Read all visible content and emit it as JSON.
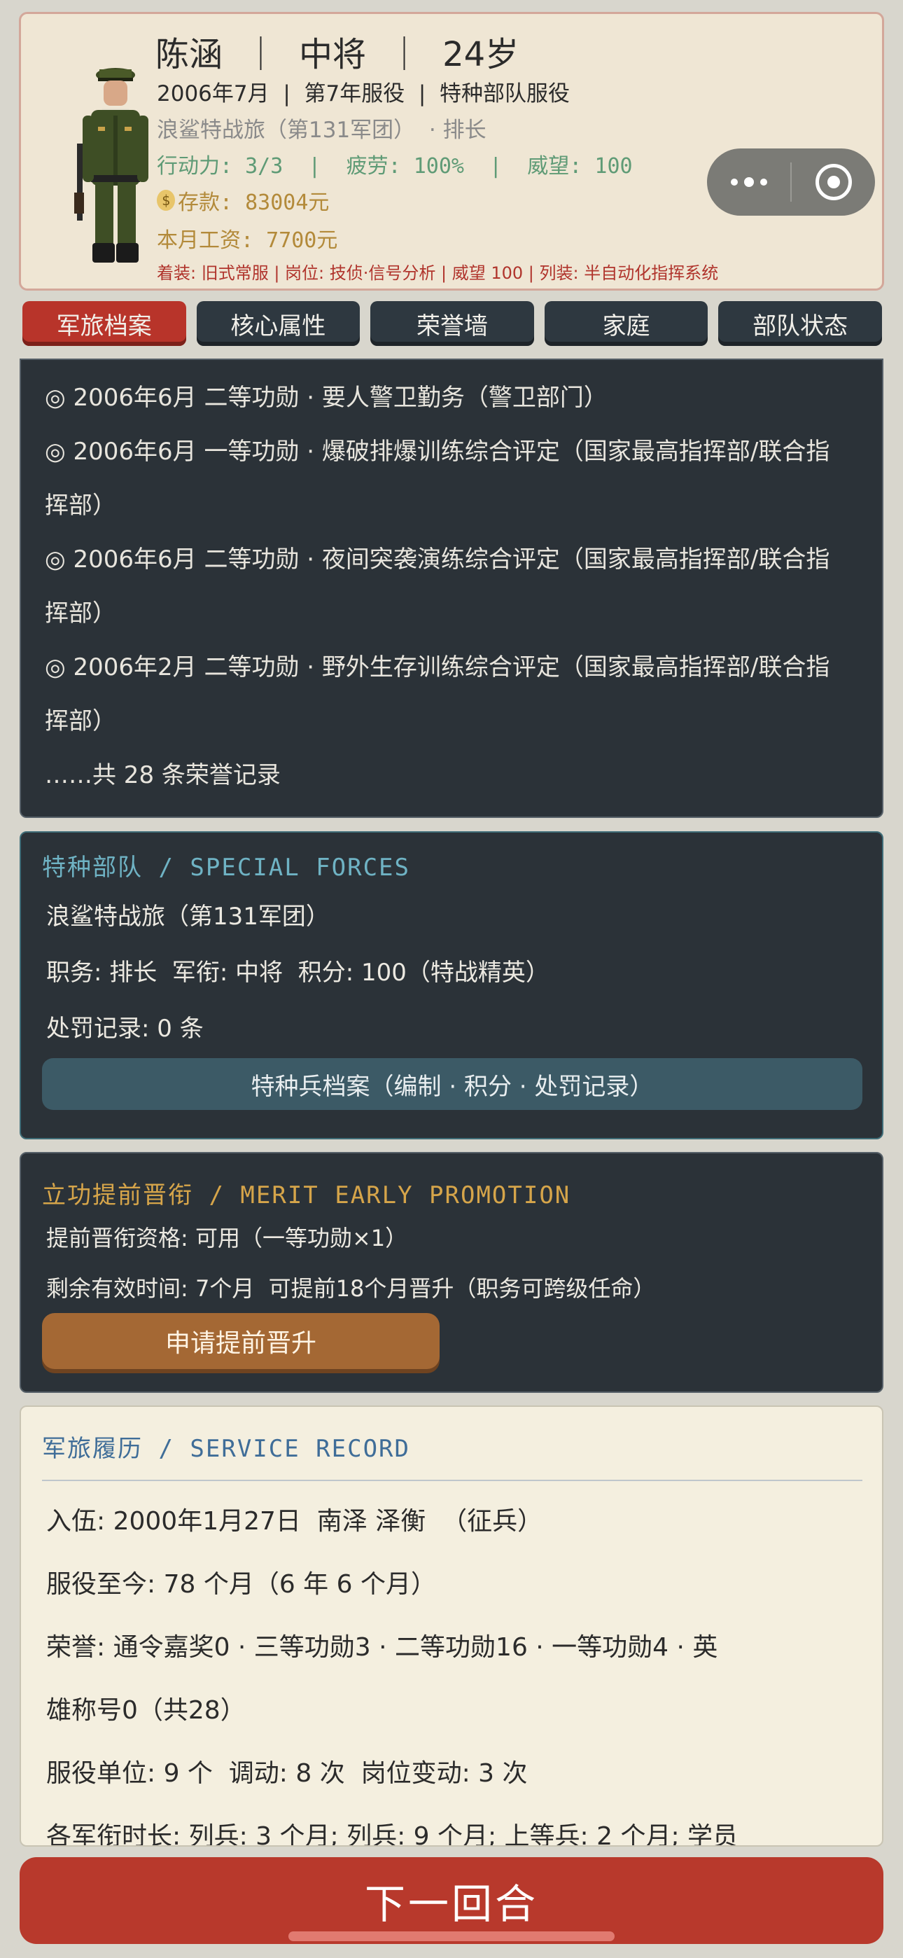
{
  "header": {
    "name_line": "陈涵  ｜  中将  ｜  24岁",
    "line2": "2006年7月  |  第7年服役  |  特种部队服役",
    "line3": "浪鲨特战旅（第131军团）  · 排长",
    "line4": "行动力: 3/3  |  疲劳: 100%  |  威望: 100",
    "coin_icon": "$",
    "savings": "存款: 83004元",
    "salary": "本月工资: 7700元",
    "line7": "着装: 旧式常服 | 岗位: 技侦·信号分析 | 威望 100 | 列装: 半自动化指挥系统"
  },
  "tabs": [
    "军旅档案",
    "核心属性",
    "荣誉墙",
    "家庭",
    "部队状态"
  ],
  "honors": {
    "items": [
      "◎ 2006年6月 二等功勋 · 要人警卫勤务（警卫部门）",
      "◎ 2006年6月 一等功勋 · 爆破排爆训练综合评定（国家最高指挥部/联合指",
      "挥部）",
      "◎ 2006年6月 二等功勋 · 夜间突袭演练综合评定（国家最高指挥部/联合指",
      "挥部）",
      "◎ 2006年2月 二等功勋 · 野外生存训练综合评定（国家最高指挥部/联合指",
      "挥部）"
    ],
    "more": "……共 28 条荣誉记录"
  },
  "special_forces": {
    "title": "特种部队 / SPECIAL FORCES",
    "unit": "浪鲨特战旅（第131军团）",
    "position_line": "职务: 排长  军衔: 中将  积分: 100（特战精英）",
    "penalty": "处罚记录: 0 条",
    "button": "特种兵档案（编制 · 积分 · 处罚记录）"
  },
  "merit": {
    "title": "立功提前晋衔 / MERIT EARLY PROMOTION",
    "eligibility": "提前晋衔资格: 可用（一等功勋×1）",
    "remaining": "剩余有效时间: 7个月  可提前18个月晋升（职务可跨级任命）",
    "button": "申请提前晋升"
  },
  "record": {
    "title": "军旅履历 / SERVICE RECORD",
    "enlist": "入伍: 2000年1月27日  南泽 泽衡  （征兵）",
    "duration": "服役至今: 78 个月（6 年 6 个月）",
    "honors_line1": "荣誉: 通令嘉奖0 · 三等功勋3 · 二等功勋16 · 一等功勋4 · 英",
    "honors_line2": "雄称号0（共28）",
    "units": "服役单位: 9 个  调动: 8 次  岗位变动: 3 次",
    "rank_time": "各军衔时长: 列兵: 3 个月; 列兵: 9 个月; 上等兵: 2 个月; 学员"
  },
  "next_turn": "下一回合"
}
